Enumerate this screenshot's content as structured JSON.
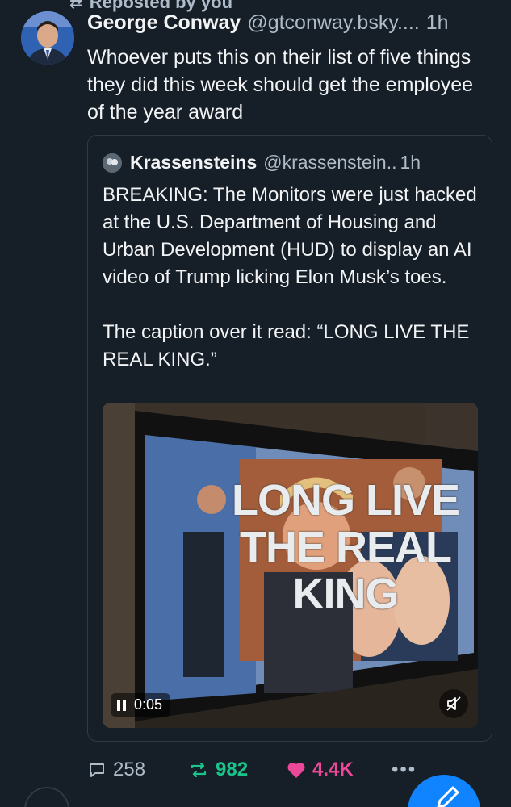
{
  "repost_banner": {
    "label": "Reposted by you"
  },
  "post": {
    "author_name": "George Conway",
    "handle": "@gtconway.bsky....",
    "time": "1h",
    "text": "Whoever puts this on their list of five things they did this week should get the employee of the year award"
  },
  "quote": {
    "author_name": "Krassensteins",
    "handle": "@krassenstein..",
    "time": "1h",
    "paragraph1": "BREAKING: The Monitors were just hacked at the U.S. Department of Housing and Urban Development (HUD) to display an AI video of Trump licking Elon Musk’s toes.",
    "paragraph2": "The caption over it read: “LONG LIVE THE REAL KING.”",
    "video": {
      "overlay_line1": "LONG LIVE",
      "overlay_line2": "THE REAL",
      "overlay_line3": "KING",
      "time": "0:05"
    }
  },
  "actions": {
    "replies": "258",
    "reposts": "982",
    "likes": "4.4K",
    "more": "•••"
  },
  "colors": {
    "background": "#161e27",
    "repost_active": "#19c58a",
    "like_active": "#ec4899",
    "fab": "#1083fe"
  },
  "icons": [
    "reply-icon",
    "repost-icon",
    "heart-icon",
    "more-icon",
    "pause-icon",
    "mute-icon",
    "compose-icon"
  ]
}
